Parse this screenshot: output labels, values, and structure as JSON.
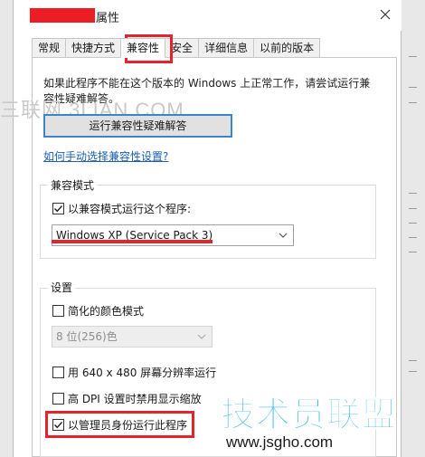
{
  "window": {
    "title": "属性"
  },
  "tabs": [
    {
      "label": "常规",
      "active": false
    },
    {
      "label": "快捷方式",
      "active": false
    },
    {
      "label": "兼容性",
      "active": true
    },
    {
      "label": "安全",
      "active": false
    },
    {
      "label": "详细信息",
      "active": false
    },
    {
      "label": "以前的版本",
      "active": false
    }
  ],
  "intro": {
    "text": "如果此程序不能在这个版本的 Windows 上正常工作，请尝试运行兼容性疑难解答。"
  },
  "buttons": {
    "troubleshooter": "运行兼容性疑难解答"
  },
  "links": {
    "manual": "如何手动选择兼容性设置?"
  },
  "compat_mode": {
    "group_label": "兼容模式",
    "checkbox_label": "以兼容模式运行这个程序:",
    "checked": true,
    "selected_os": "Windows XP (Service Pack 3)"
  },
  "settings": {
    "group_label": "设置",
    "reduced_color": {
      "label": "简化的颜色模式",
      "checked": false
    },
    "color_select": "8 位(256)色",
    "res_640": {
      "label": "用 640 x 480 屏幕分辨率运行",
      "checked": false
    },
    "high_dpi": {
      "label": "高 DPI 设置时禁用显示缩放",
      "checked": false
    },
    "run_admin": {
      "label": "以管理员身份运行此程序",
      "checked": true
    }
  },
  "watermarks": {
    "site1": "三联网 3LIAN.COM",
    "logo": "技术员联盟",
    "logo_url": "www.jsgho.com"
  },
  "colors": {
    "highlight": "#e4242b",
    "button_border": "#3b86c6",
    "link": "#1a5fb4",
    "logo": "#2ab6e8"
  }
}
